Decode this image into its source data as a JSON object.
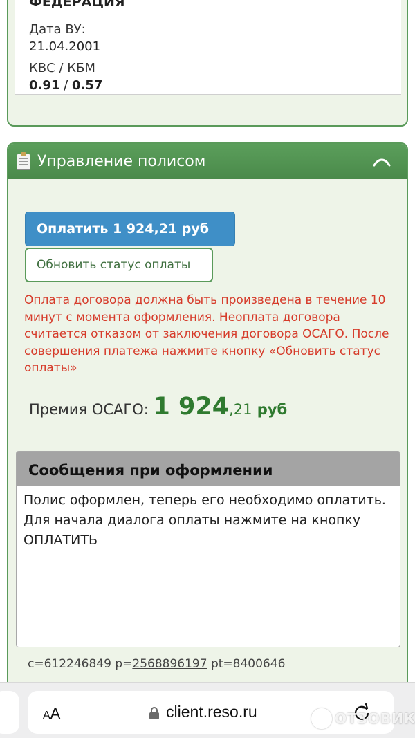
{
  "driver": {
    "country": "ФЕДЕРАЦИЯ",
    "license_date_label": "Дата ВУ:",
    "license_date_value": "21.04.2001",
    "kvs_label": "КВС / КБМ",
    "kvs_value": "0.91",
    "kvs_sep": " / ",
    "kbm_value": "0.57"
  },
  "policy": {
    "title": "Управление полисом",
    "pay_button": "Оплатить 1 924,21 руб",
    "refresh_button": "Обновить статус оплаты",
    "warning": "Оплата договора должна быть произведена в течение 10 минут с момента оформления. Неоплата договора считается отказом от заключения договора ОСАГО. После совершения платежа нажмите кнопку «Обновить статус оплаты»",
    "premium_label": "Премия ОСАГО: ",
    "premium_int": "1 924",
    "premium_frac": ",21",
    "premium_currency": " руб",
    "messages_title": "Сообщения при оформлении",
    "messages_line1": "Полис оформлен, теперь его необходимо оплатить.",
    "messages_line2": "Для начала диалога оплаты нажмите на кнопку ОПЛАТИТЬ",
    "ids_c": "c=612246849",
    "ids_p_label": " p=",
    "ids_p_value": "2568896197",
    "ids_pt": " pt=8400646"
  },
  "browser": {
    "aa_small": "A",
    "aa_large": "A",
    "url": "client.reso.ru",
    "watermark": "ОТЗОВИК"
  },
  "colors": {
    "accent_green": "#4f8f4f",
    "pay_blue": "#3f8fc7",
    "warning_red": "#d63b2a",
    "premium_green": "#2f7a2f"
  }
}
